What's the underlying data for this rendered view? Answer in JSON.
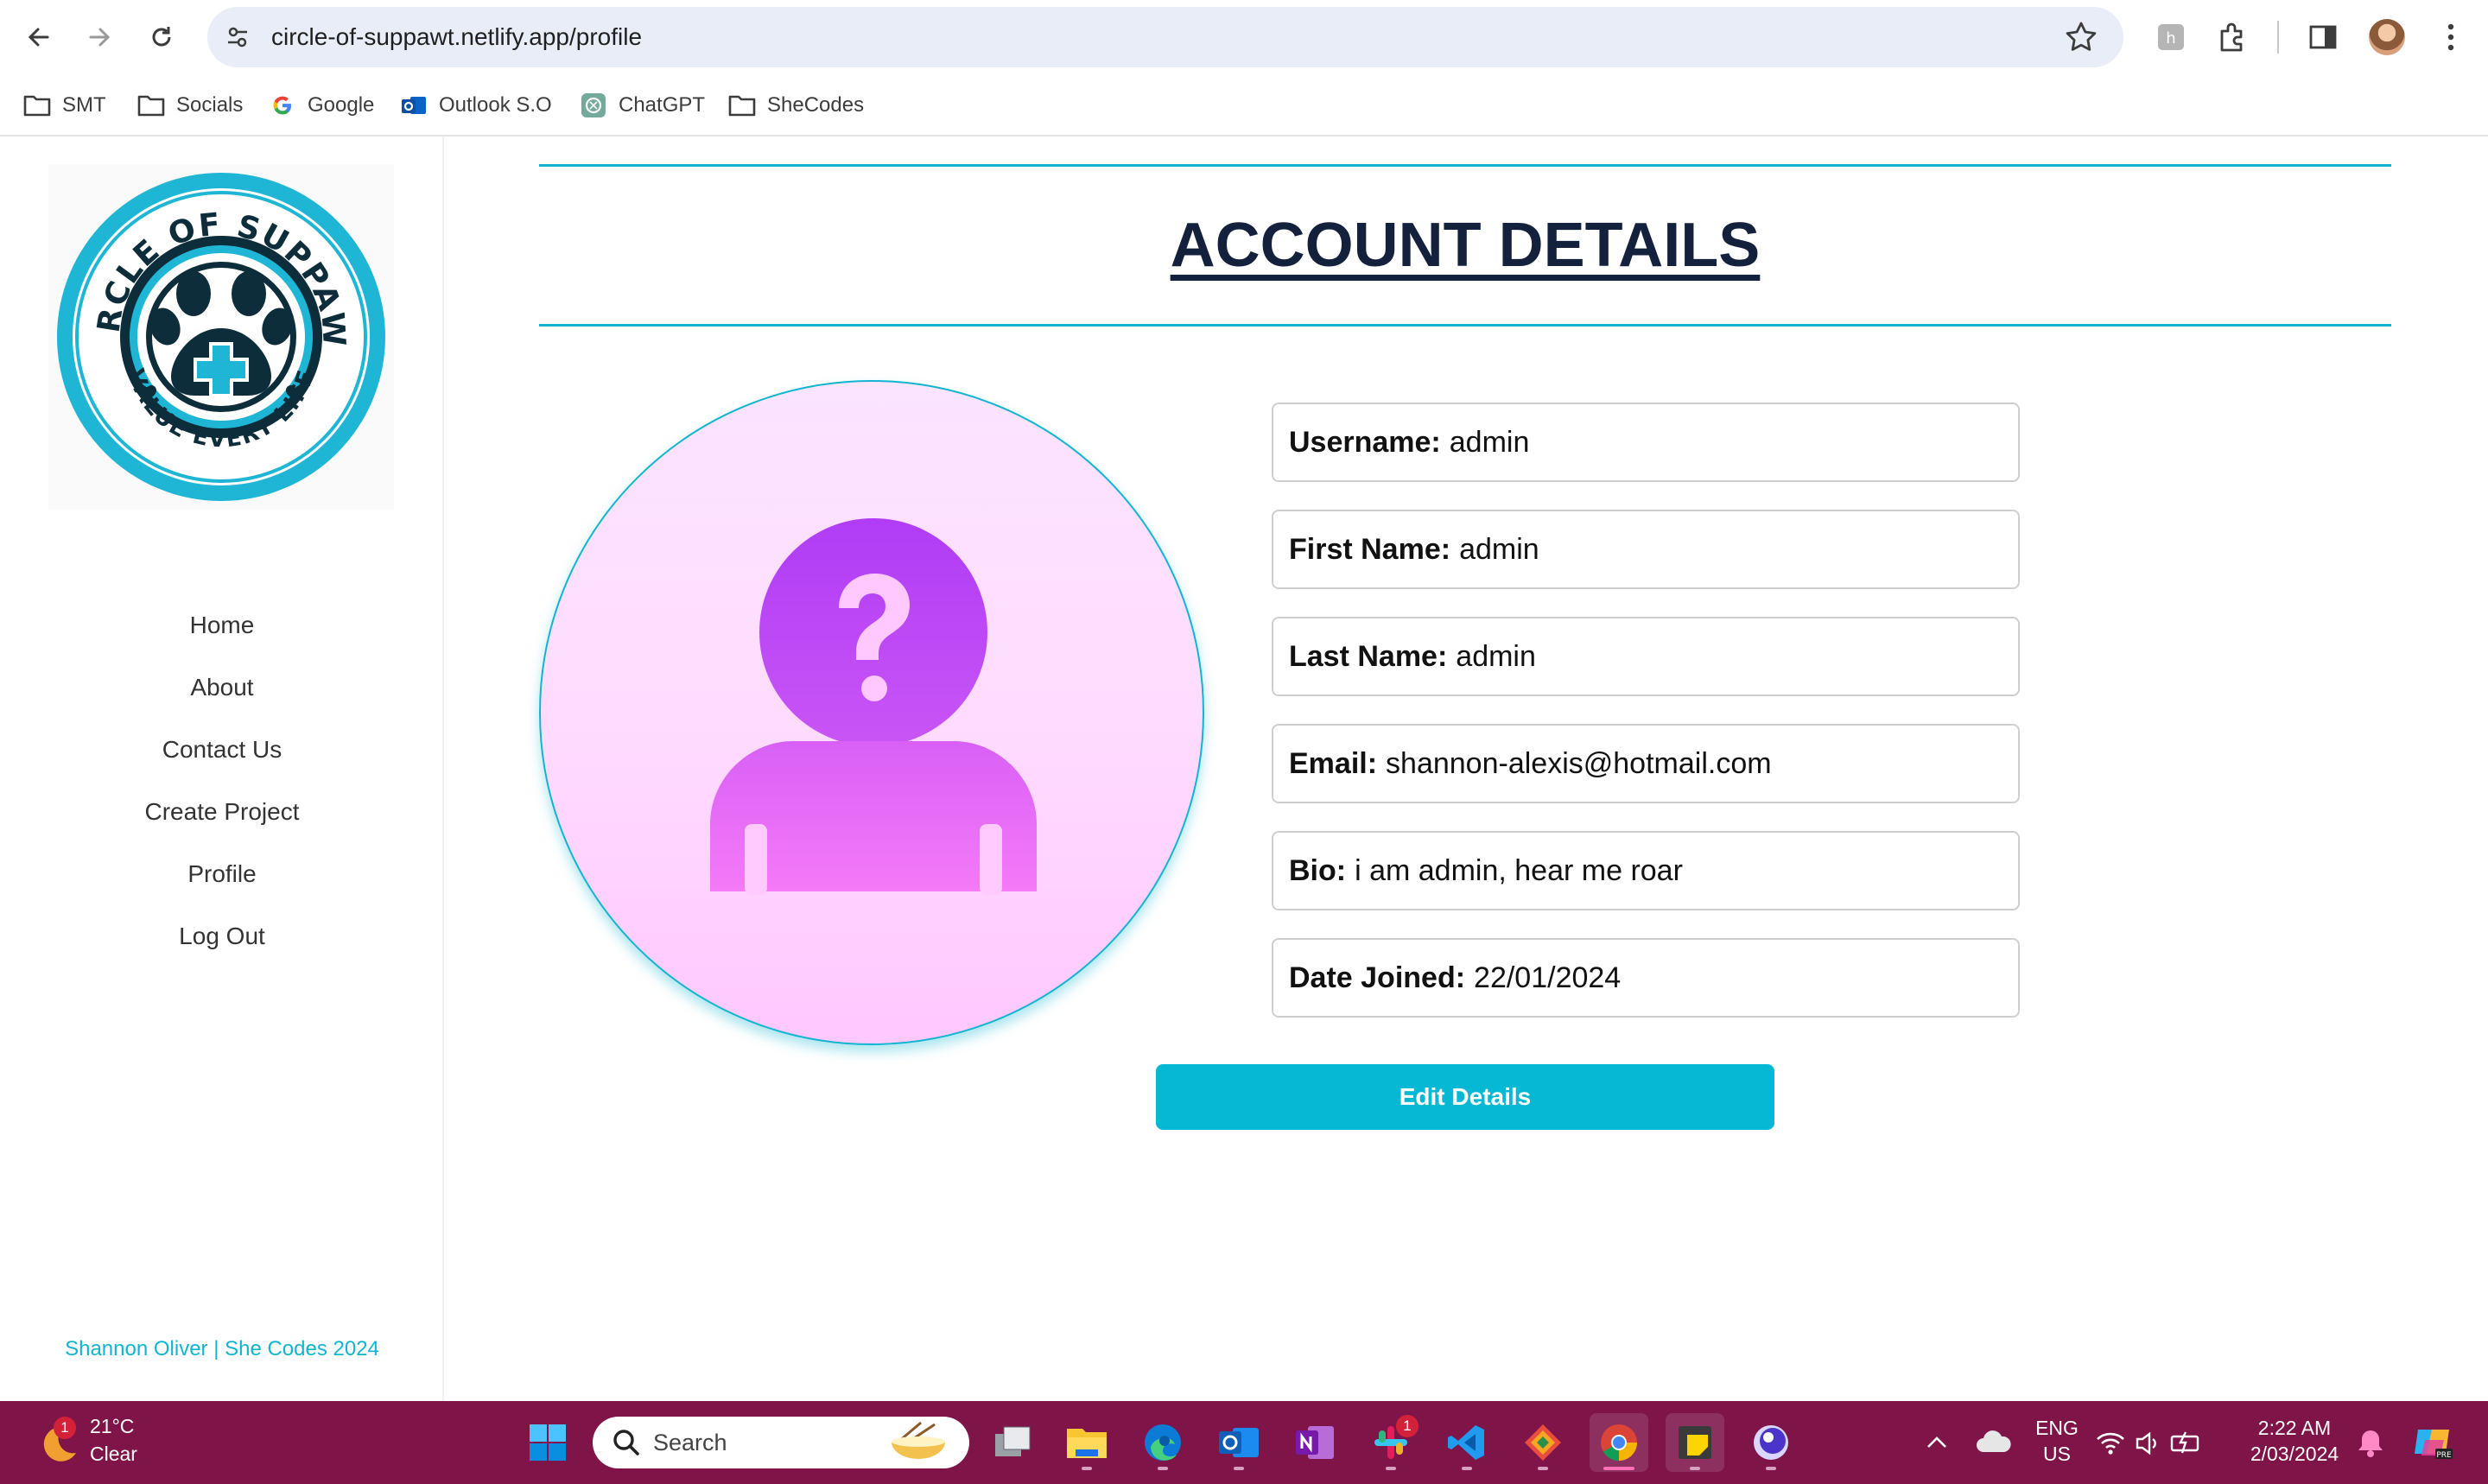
{
  "browser": {
    "url": "circle-of-suppawt.netlify.app/profile",
    "bookmarks": [
      {
        "label": "SMT",
        "icon": "folder-icon"
      },
      {
        "label": "Socials",
        "icon": "folder-icon"
      },
      {
        "label": "Google",
        "icon": "google-icon"
      },
      {
        "label": "Outlook S.O",
        "icon": "outlook-icon"
      },
      {
        "label": "ChatGPT",
        "icon": "chatgpt-icon"
      },
      {
        "label": "SheCodes",
        "icon": "folder-icon"
      }
    ]
  },
  "sidebar": {
    "logo": {
      "top_text": "CIRCLE OF SUPPAWT",
      "bottom_text": "VALUE EVERY LIFE"
    },
    "nav": [
      {
        "label": "Home"
      },
      {
        "label": "About"
      },
      {
        "label": "Contact Us"
      },
      {
        "label": "Create Project"
      },
      {
        "label": "Profile"
      },
      {
        "label": "Log Out"
      }
    ],
    "footer": "Shannon Oliver | She Codes 2024"
  },
  "main": {
    "title": "ACCOUNT DETAILS",
    "fields": [
      {
        "label": "Username:",
        "value": "admin"
      },
      {
        "label": "First Name:",
        "value": "admin"
      },
      {
        "label": "Last Name:",
        "value": "admin"
      },
      {
        "label": "Email:",
        "value": "shannon-alexis@hotmail.com"
      },
      {
        "label": "Bio:",
        "value": "i am admin, hear me roar"
      },
      {
        "label": "Date Joined:",
        "value": "22/01/2024"
      }
    ],
    "edit_button": "Edit Details"
  },
  "taskbar": {
    "weather": {
      "temp": "21°C",
      "condition": "Clear",
      "badge": "1"
    },
    "search_placeholder": "Search",
    "slack_badge": "1",
    "language": {
      "line1": "ENG",
      "line2": "US"
    },
    "time": "2:22 AM",
    "date": "2/03/2024"
  },
  "colors": {
    "accent": "#12b5d1",
    "button": "#06b8d4",
    "title": "#14213d",
    "taskbar": "#7f1449",
    "avatar_purple": "#b73cf5",
    "avatar_pink": "#f772f7"
  }
}
